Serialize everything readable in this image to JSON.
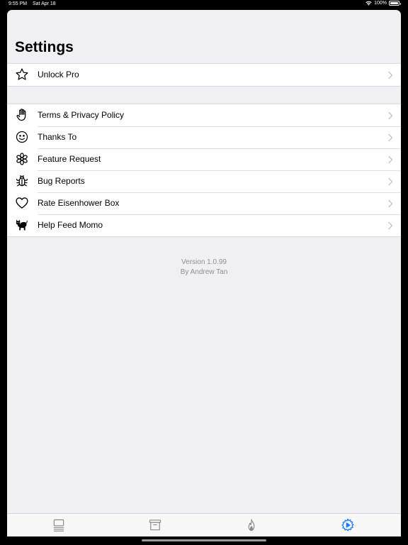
{
  "status_bar": {
    "time": "9:55 PM",
    "date": "Sat Apr 18",
    "battery": "100%",
    "battery_level": 1.0,
    "wifi_icon": "wifi-icon",
    "battery_icon": "battery-icon"
  },
  "page": {
    "title": "Settings"
  },
  "pro_section": {
    "items": [
      {
        "label": "Unlock Pro",
        "icon": "star-icon"
      }
    ]
  },
  "links_section": {
    "items": [
      {
        "label": "Terms & Privacy Policy",
        "icon": "hand-icon"
      },
      {
        "label": "Thanks To",
        "icon": "smiley-icon"
      },
      {
        "label": "Feature Request",
        "icon": "flower-icon"
      },
      {
        "label": "Bug Reports",
        "icon": "bug-icon"
      },
      {
        "label": "Rate Eisenhower Box",
        "icon": "heart-icon"
      },
      {
        "label": "Help Feed Momo",
        "icon": "cat-icon"
      }
    ]
  },
  "footer": {
    "version": "Version 1.0.99",
    "author": "By Andrew Tan"
  },
  "tab_bar": {
    "tabs": [
      {
        "icon": "list-icon",
        "active": false
      },
      {
        "icon": "archive-icon",
        "active": false
      },
      {
        "icon": "flame-icon",
        "active": false
      },
      {
        "icon": "settings-gear-icon",
        "active": true
      }
    ]
  },
  "colors": {
    "accent": "#1a7cf5",
    "background": "#efeff4",
    "tab_inactive": "#8a8a8e",
    "chevron": "#c7c7cc"
  }
}
